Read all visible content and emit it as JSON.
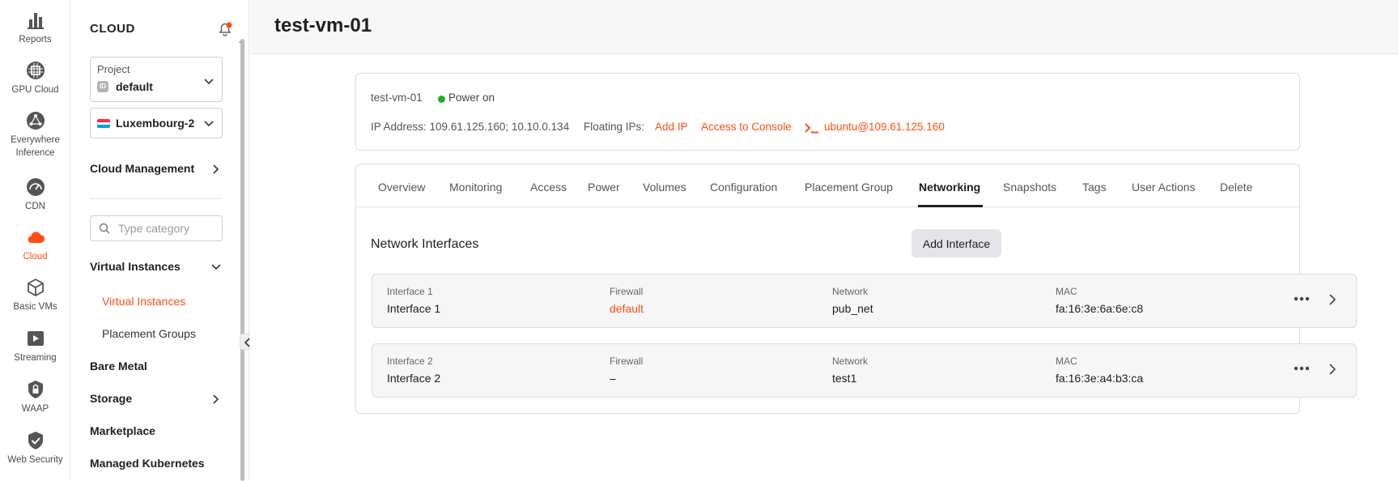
{
  "rail": {
    "items": [
      {
        "label": "Reports",
        "icon": "bar-chart-icon"
      },
      {
        "label": "GPU Cloud",
        "icon": "gpu-chip-icon"
      },
      {
        "label": "Everywhere Inference",
        "icon": "network-nodes-icon"
      },
      {
        "label": "CDN",
        "icon": "speedometer-icon"
      },
      {
        "label": "Cloud",
        "icon": "cloud-icon"
      },
      {
        "label": "Basic VMs",
        "icon": "cube-icon"
      },
      {
        "label": "Streaming",
        "icon": "play-icon"
      },
      {
        "label": "WAAP",
        "icon": "lock-shield-icon"
      },
      {
        "label": "Web Security",
        "icon": "check-shield-icon"
      }
    ],
    "active": "Cloud"
  },
  "sidebar": {
    "title": "CLOUD",
    "project": {
      "label": "Project",
      "badge": "ID",
      "value": "default"
    },
    "region": {
      "value": "Luxembourg-2"
    },
    "cloud_management": "Cloud Management",
    "search": {
      "placeholder": "Type category"
    },
    "virtual_instances": "Virtual Instances",
    "sub_virtual_instances": "Virtual Instances",
    "sub_placement_groups": "Placement Groups",
    "bare_metal": "Bare Metal",
    "storage": "Storage",
    "marketplace": "Marketplace",
    "managed_kubernetes": "Managed Kubernetes"
  },
  "header": {
    "title": "test-vm-01"
  },
  "info": {
    "vm_name": "test-vm-01",
    "power_state": "Power on",
    "ip_label": "IP Address: 109.61.125.160; 10.10.0.134",
    "floating_label": "Floating IPs:",
    "add_ip": "Add IP",
    "access_console": "Access to Console",
    "ssh": "ubuntu@109.61.125.160"
  },
  "tabs": [
    "Overview",
    "Monitoring",
    "Access",
    "Power",
    "Volumes",
    "Configuration",
    "Placement Group",
    "Networking",
    "Snapshots",
    "Tags",
    "User Actions",
    "Delete"
  ],
  "active_tab": "Networking",
  "network": {
    "title": "Network Interfaces",
    "add_button": "Add Interface",
    "columns": {
      "firewall": "Firewall",
      "network": "Network",
      "mac": "MAC"
    },
    "rows": [
      {
        "header": "Interface 1",
        "name": "Interface 1",
        "firewall": "default",
        "network": "pub_net",
        "mac": "fa:16:3e:6a:6e:c8"
      },
      {
        "header": "Interface 2",
        "name": "Interface 2",
        "firewall": "–",
        "network": "test1",
        "mac": "fa:16:3e:a4:b3:ca"
      }
    ]
  },
  "colors": {
    "accent": "#ff4f12",
    "status_on": "#27a53a"
  }
}
